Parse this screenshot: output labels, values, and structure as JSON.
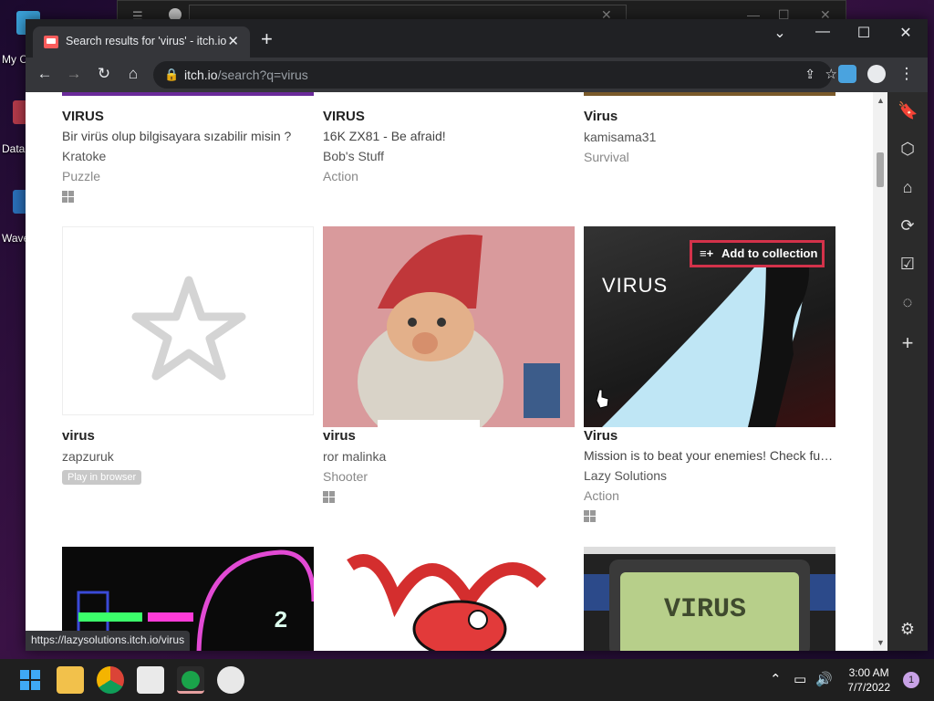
{
  "browser": {
    "tab_title": "Search results for 'virus' - itch.io",
    "url_host": "itch.io",
    "url_path": "/search?q=virus",
    "status_url": "https://lazysolutions.itch.io/virus"
  },
  "desktop": {
    "icons": [
      "My C",
      "Data",
      "Wave"
    ]
  },
  "results_row1": [
    {
      "name": "VIRUS",
      "desc": "Bir virüs olup bilgisayara sızabilir misin ?",
      "author": "Kratoke",
      "genre": "Puzzle",
      "windows": true
    },
    {
      "name": "VIRUS",
      "desc": "16K ZX81 - Be afraid!",
      "author": "Bob's Stuff",
      "genre": "Action",
      "windows": false
    },
    {
      "name": "Virus",
      "desc": "",
      "author": "kamisama31",
      "genre": "Survival",
      "windows": false
    }
  ],
  "results_row2": [
    {
      "name": "virus",
      "author": "zapzuruk",
      "badge": "Play in browser"
    },
    {
      "name": "virus",
      "author": "ror malinka",
      "genre": "Shooter",
      "windows": true
    },
    {
      "name": "Virus",
      "desc": "Mission is to beat your enemies! Check full ...",
      "author": "Lazy Solutions",
      "genre": "Action",
      "windows": true
    }
  ],
  "add_to_collection": "Add to collection",
  "thumb_text": {
    "virus_logo": "VIRUS",
    "retro_title": "VIRUS"
  },
  "taskbar": {
    "time": "3:00 AM",
    "date": "7/7/2022",
    "notifications": "1"
  }
}
